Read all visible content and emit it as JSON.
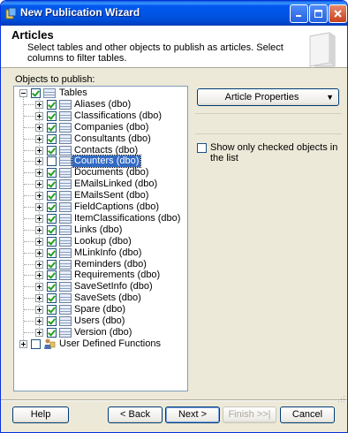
{
  "window": {
    "title": "New Publication Wizard"
  },
  "header": {
    "title": "Articles",
    "description": "Select tables and other objects to publish as articles. Select columns to filter tables."
  },
  "objects_label": "Objects to publish:",
  "tree": {
    "root_label": "Tables",
    "tables": [
      {
        "label": "Aliases (dbo)",
        "checked": true
      },
      {
        "label": "Classifications (dbo)",
        "checked": true
      },
      {
        "label": "Companies (dbo)",
        "checked": true
      },
      {
        "label": "Consultants (dbo)",
        "checked": true
      },
      {
        "label": "Contacts (dbo)",
        "checked": true
      },
      {
        "label": "Counters (dbo)",
        "checked": false,
        "selected": true
      },
      {
        "label": "Documents (dbo)",
        "checked": true
      },
      {
        "label": "EMailsLinked (dbo)",
        "checked": true
      },
      {
        "label": "EMailsSent (dbo)",
        "checked": true
      },
      {
        "label": "FieldCaptions (dbo)",
        "checked": true
      },
      {
        "label": "ItemClassifications (dbo)",
        "checked": true
      },
      {
        "label": "Links (dbo)",
        "checked": true
      },
      {
        "label": "Lookup (dbo)",
        "checked": true
      },
      {
        "label": "MLinkInfo (dbo)",
        "checked": true
      },
      {
        "label": "Reminders (dbo)",
        "checked": true
      },
      {
        "label": "Requirements (dbo)",
        "checked": true
      },
      {
        "label": "SaveSetInfo (dbo)",
        "checked": true
      },
      {
        "label": "SaveSets (dbo)",
        "checked": true
      },
      {
        "label": "Spare (dbo)",
        "checked": true
      },
      {
        "label": "Users (dbo)",
        "checked": true
      },
      {
        "label": "Version (dbo)",
        "checked": true
      }
    ],
    "udf_label": "User Defined Functions"
  },
  "article_properties_label": "Article Properties",
  "show_only_checked_label": "Show only checked objects in the list",
  "buttons": {
    "help": "Help",
    "back": "< Back",
    "next": "Next >",
    "finish": "Finish >>|",
    "cancel": "Cancel"
  }
}
